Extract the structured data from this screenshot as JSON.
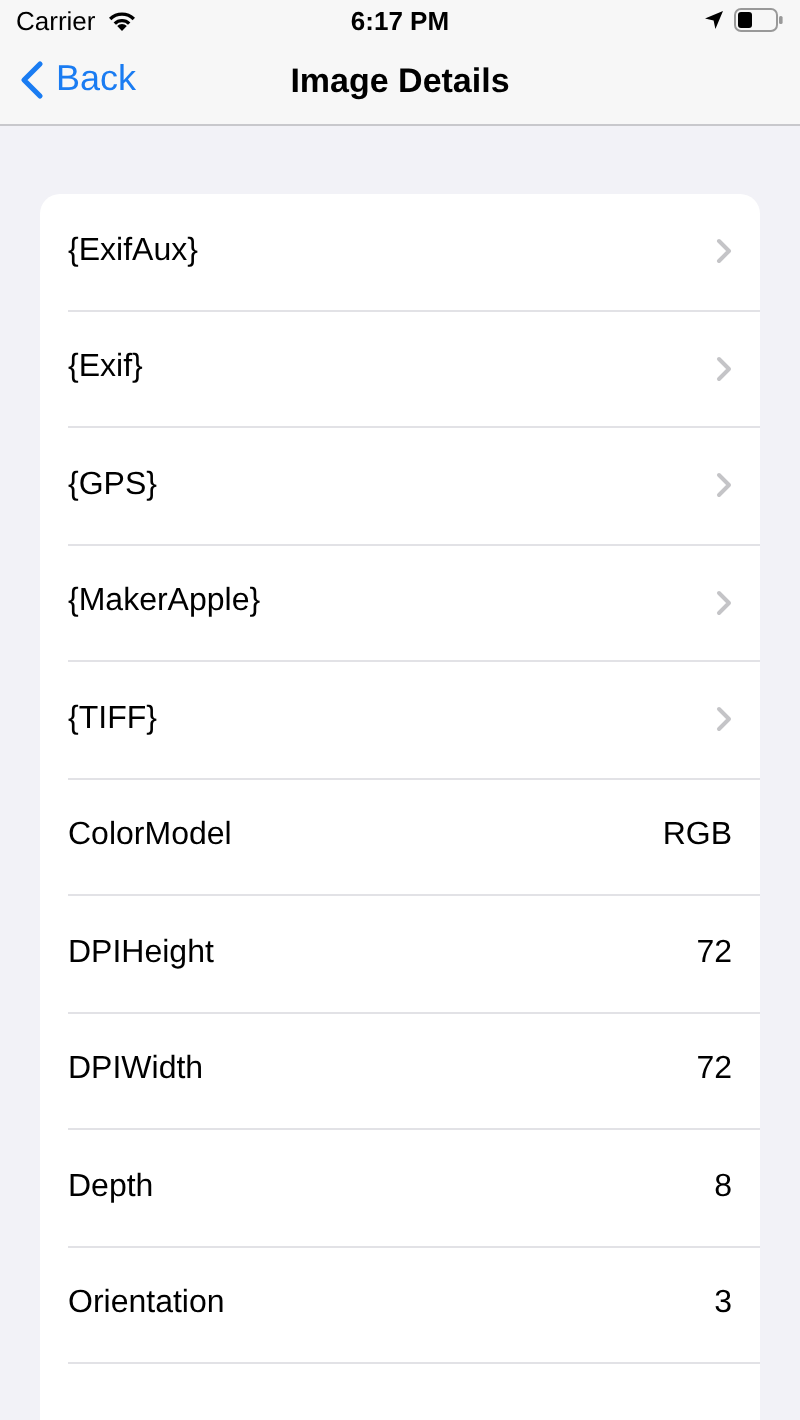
{
  "status_bar": {
    "carrier": "Carrier",
    "time": "6:17 PM"
  },
  "nav": {
    "back": "Back",
    "title": "Image Details"
  },
  "rows": [
    {
      "kind": "link",
      "label": "{ExifAux}"
    },
    {
      "kind": "link",
      "label": "{Exif}"
    },
    {
      "kind": "link",
      "label": "{GPS}"
    },
    {
      "kind": "link",
      "label": "{MakerApple}"
    },
    {
      "kind": "link",
      "label": "{TIFF}"
    },
    {
      "kind": "value",
      "label": "ColorModel",
      "value": "RGB"
    },
    {
      "kind": "value",
      "label": "DPIHeight",
      "value": "72"
    },
    {
      "kind": "value",
      "label": "DPIWidth",
      "value": "72"
    },
    {
      "kind": "value",
      "label": "Depth",
      "value": "8"
    },
    {
      "kind": "value",
      "label": "Orientation",
      "value": "3"
    }
  ]
}
